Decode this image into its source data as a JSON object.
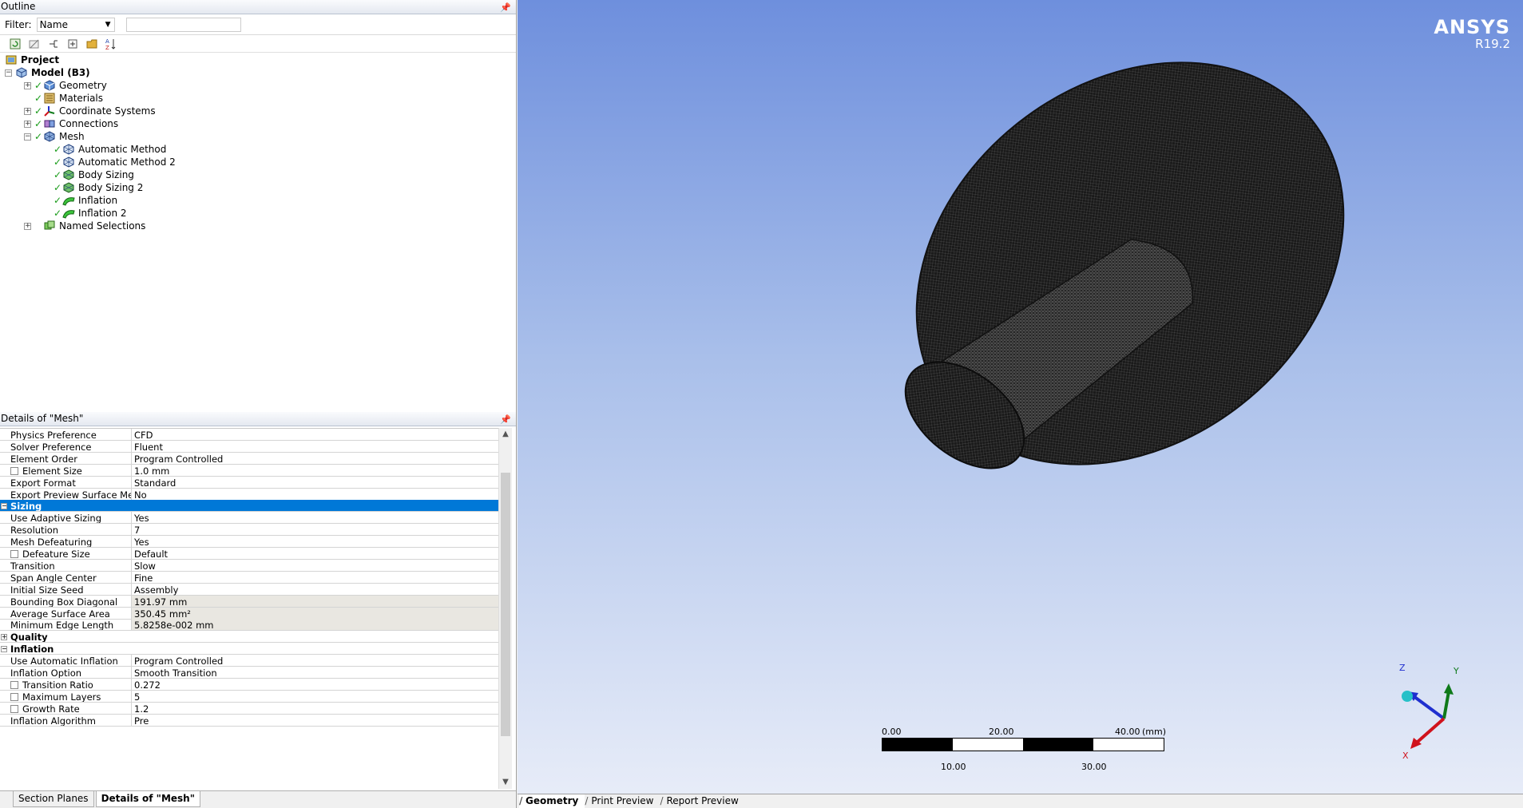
{
  "outline": {
    "title": "Outline",
    "filter_label": "Filter:",
    "filter_value": "Name",
    "filter_text": "",
    "tree": [
      {
        "label": "Project",
        "level": 0,
        "expander": "",
        "check": false,
        "bold": true,
        "icon": "project-icon"
      },
      {
        "label": "Model (B3)",
        "level": 1,
        "expander": "−",
        "check": false,
        "bold": true,
        "icon": "model-icon"
      },
      {
        "label": "Geometry",
        "level": 2,
        "expander": "+",
        "check": true,
        "bold": false,
        "icon": "geometry-icon"
      },
      {
        "label": "Materials",
        "level": 2,
        "expander": "",
        "check": true,
        "bold": false,
        "icon": "materials-icon"
      },
      {
        "label": "Coordinate Systems",
        "level": 2,
        "expander": "+",
        "check": true,
        "bold": false,
        "icon": "coordinate-systems-icon"
      },
      {
        "label": "Connections",
        "level": 2,
        "expander": "+",
        "check": true,
        "bold": false,
        "icon": "connections-icon"
      },
      {
        "label": "Mesh",
        "level": 2,
        "expander": "−",
        "check": true,
        "bold": false,
        "icon": "mesh-icon"
      },
      {
        "label": "Automatic Method",
        "level": 3,
        "expander": "",
        "check": true,
        "bold": false,
        "icon": "method-icon"
      },
      {
        "label": "Automatic Method 2",
        "level": 3,
        "expander": "",
        "check": true,
        "bold": false,
        "icon": "method-icon"
      },
      {
        "label": "Body Sizing",
        "level": 3,
        "expander": "",
        "check": true,
        "bold": false,
        "icon": "sizing-icon"
      },
      {
        "label": "Body Sizing 2",
        "level": 3,
        "expander": "",
        "check": true,
        "bold": false,
        "icon": "sizing-icon"
      },
      {
        "label": "Inflation",
        "level": 3,
        "expander": "",
        "check": true,
        "bold": false,
        "icon": "inflation-icon"
      },
      {
        "label": "Inflation 2",
        "level": 3,
        "expander": "",
        "check": true,
        "bold": false,
        "icon": "inflation-icon"
      },
      {
        "label": "Named Selections",
        "level": 2,
        "expander": "+",
        "check": false,
        "bold": false,
        "icon": "named-selections-icon"
      }
    ]
  },
  "details": {
    "title": "Details of \"Mesh\"",
    "rows": [
      {
        "kind": "prop",
        "key": "Physics Preference",
        "value": "CFD",
        "checkbox": false,
        "readonly": false
      },
      {
        "kind": "prop",
        "key": "Solver Preference",
        "value": "Fluent",
        "checkbox": false,
        "readonly": false
      },
      {
        "kind": "prop",
        "key": "Element Order",
        "value": "Program Controlled",
        "checkbox": false,
        "readonly": false
      },
      {
        "kind": "prop",
        "key": "Element Size",
        "value": "1.0 mm",
        "checkbox": true,
        "readonly": false
      },
      {
        "kind": "prop",
        "key": "Export Format",
        "value": "Standard",
        "checkbox": false,
        "readonly": false
      },
      {
        "kind": "prop",
        "key": "Export Preview Surface Mesh",
        "value": "No",
        "checkbox": false,
        "readonly": false
      },
      {
        "kind": "group",
        "key": "Sizing",
        "expander": "−",
        "selected": true
      },
      {
        "kind": "prop",
        "key": "Use Adaptive Sizing",
        "value": "Yes",
        "checkbox": false,
        "readonly": false
      },
      {
        "kind": "prop",
        "key": "Resolution",
        "value": "7",
        "checkbox": false,
        "readonly": false
      },
      {
        "kind": "prop",
        "key": "Mesh Defeaturing",
        "value": "Yes",
        "checkbox": false,
        "readonly": false
      },
      {
        "kind": "prop",
        "key": "Defeature Size",
        "value": "Default",
        "checkbox": true,
        "readonly": false
      },
      {
        "kind": "prop",
        "key": "Transition",
        "value": "Slow",
        "checkbox": false,
        "readonly": false
      },
      {
        "kind": "prop",
        "key": "Span Angle Center",
        "value": "Fine",
        "checkbox": false,
        "readonly": false
      },
      {
        "kind": "prop",
        "key": "Initial Size Seed",
        "value": "Assembly",
        "checkbox": false,
        "readonly": false
      },
      {
        "kind": "prop",
        "key": "Bounding Box Diagonal",
        "value": "191.97 mm",
        "checkbox": false,
        "readonly": true
      },
      {
        "kind": "prop",
        "key": "Average Surface Area",
        "value": "350.45 mm²",
        "checkbox": false,
        "readonly": true
      },
      {
        "kind": "prop",
        "key": "Minimum Edge Length",
        "value": "5.8258e-002 mm",
        "checkbox": false,
        "readonly": true
      },
      {
        "kind": "group",
        "key": "Quality",
        "expander": "+",
        "selected": false
      },
      {
        "kind": "group",
        "key": "Inflation",
        "expander": "−",
        "selected": false
      },
      {
        "kind": "prop",
        "key": "Use Automatic Inflation",
        "value": "Program Controlled",
        "checkbox": false,
        "readonly": false
      },
      {
        "kind": "prop",
        "key": "Inflation Option",
        "value": "Smooth Transition",
        "checkbox": false,
        "readonly": false
      },
      {
        "kind": "prop",
        "key": "Transition Ratio",
        "value": "0.272",
        "checkbox": true,
        "readonly": false
      },
      {
        "kind": "prop",
        "key": "Maximum Layers",
        "value": "5",
        "checkbox": true,
        "readonly": false
      },
      {
        "kind": "prop",
        "key": "Growth Rate",
        "value": "1.2",
        "checkbox": true,
        "readonly": false
      },
      {
        "kind": "prop",
        "key": "Inflation Algorithm",
        "value": "Pre",
        "checkbox": false,
        "readonly": false
      }
    ]
  },
  "bottom_tabs": [
    {
      "label": "Section Planes",
      "active": false
    },
    {
      "label": "Details of \"Mesh\"",
      "active": true
    }
  ],
  "viewport": {
    "brand": "ANSYS",
    "version": "R19.2",
    "scale": {
      "top_labels": [
        "0.00",
        "20.00",
        "40.00"
      ],
      "unit": "(mm)",
      "bottom_labels": [
        "10.00",
        "30.00"
      ]
    },
    "triad": {
      "z": "Z",
      "y": "Y",
      "x": "X"
    },
    "colors": {
      "z_axis": "#1f2fcf",
      "y_axis": "#0f7a1a",
      "x_axis": "#d0121c",
      "origin": "#26c0c8"
    }
  },
  "view_tabs": [
    {
      "label": "Geometry",
      "active": true
    },
    {
      "label": "Print Preview",
      "active": false
    },
    {
      "label": "Report Preview",
      "active": false
    }
  ]
}
